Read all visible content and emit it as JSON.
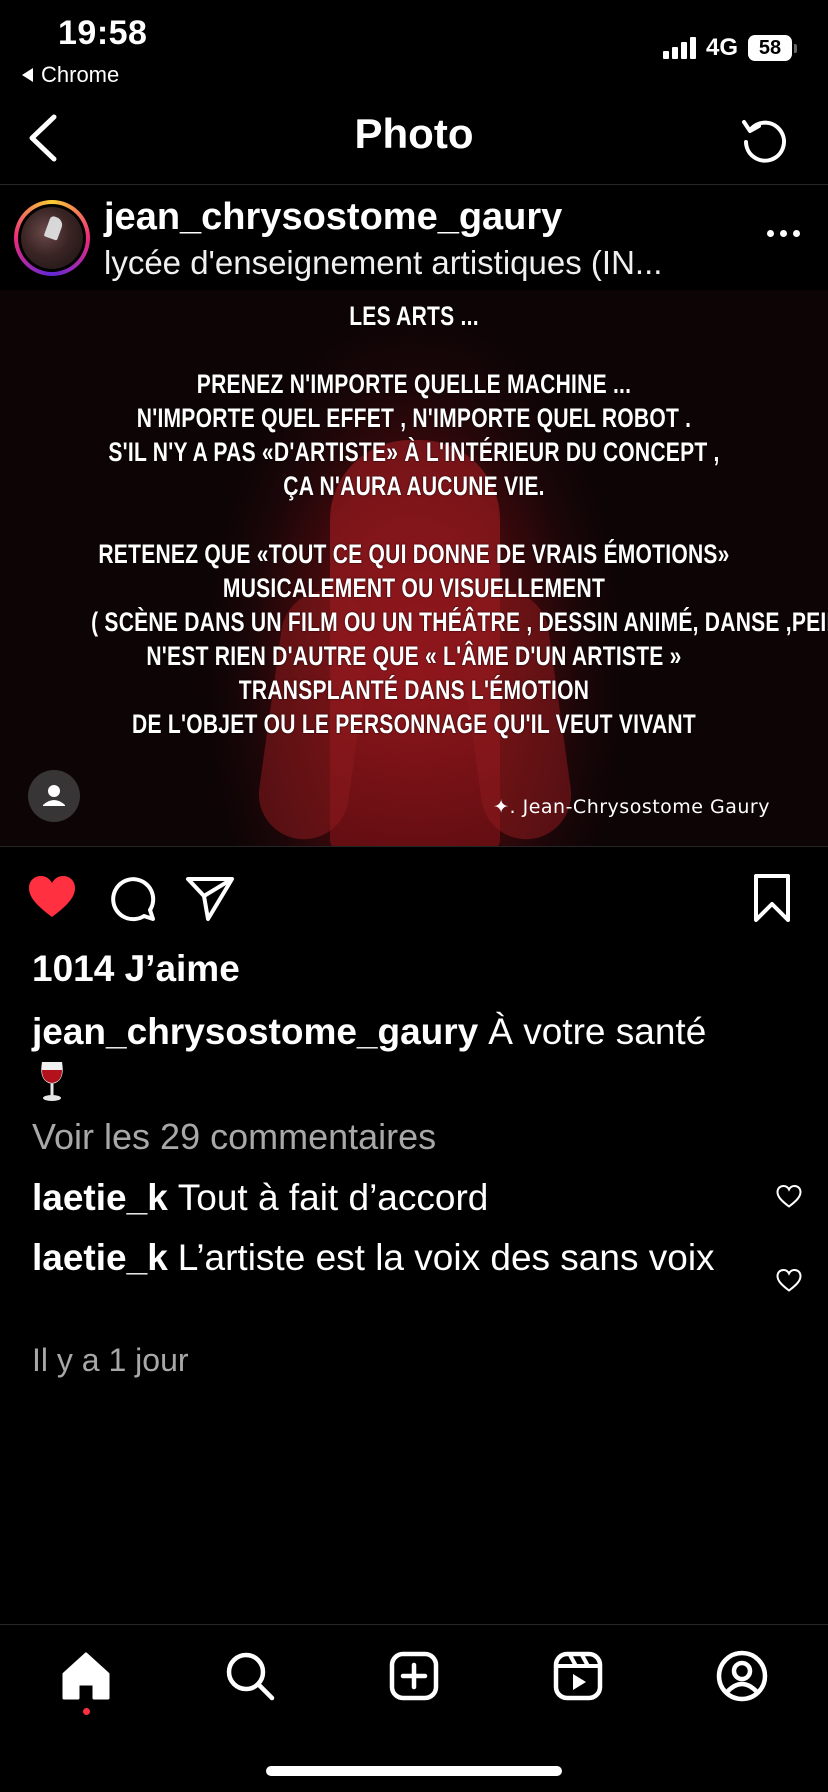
{
  "status_bar": {
    "time": "19:58",
    "back_app": "Chrome",
    "network": "4G",
    "battery": "58"
  },
  "header": {
    "title": "Photo",
    "icons": {
      "back": "chevron-left-icon",
      "refresh": "refresh-icon"
    }
  },
  "post": {
    "username": "jean_chrysostome_gaury",
    "location": "lycée d'enseignement artistiques (IN...",
    "image_text": [
      "LES ARTS ...",
      "",
      "PRENEZ N'IMPORTE QUELLE MACHINE ...",
      "N'IMPORTE QUEL EFFET , N'IMPORTE QUEL ROBOT .",
      "S'IL N'Y A PAS «D'ARTISTE» À L'INTÉRIEUR DU CONCEPT ,",
      "ÇA N'AURA AUCUNE VIE.",
      "",
      "RETENEZ QUE «TOUT CE QUI DONNE DE VRAIS ÉMOTIONS»",
      "MUSICALEMENT OU  VISUELLEMENT",
      "( SCÈNE DANS UN FILM OU UN THÉÂTRE , DESSIN ANIMÉ, DANSE ,PEINTURE ETC )",
      "N'EST RIEN D'AUTRE QUE « L'ÂME D'UN ARTISTE »",
      "TRANSPLANTÉ DANS L'ÉMOTION",
      "DE L'OBJET OU LE PERSONNAGE QU'IL VEUT VIVANT"
    ],
    "signature": "✦. Jean-Chrysostome Gaury",
    "likes": "1014 J’aime",
    "caption": {
      "username": "jean_chrysostome_gaury",
      "text": "À votre santé"
    },
    "view_comments": "Voir les 29 commentaires",
    "comments": [
      {
        "username": "laetie_k",
        "text": "Tout à fait d’accord"
      },
      {
        "username": "laetie_k",
        "text": "L’artiste est la voix des sans voix"
      }
    ],
    "time_ago": "Il y a 1 jour"
  },
  "colors": {
    "background": "#000000",
    "like_red": "#ff3040",
    "muted_text": "#a8a8a8",
    "divider": "#262626"
  }
}
